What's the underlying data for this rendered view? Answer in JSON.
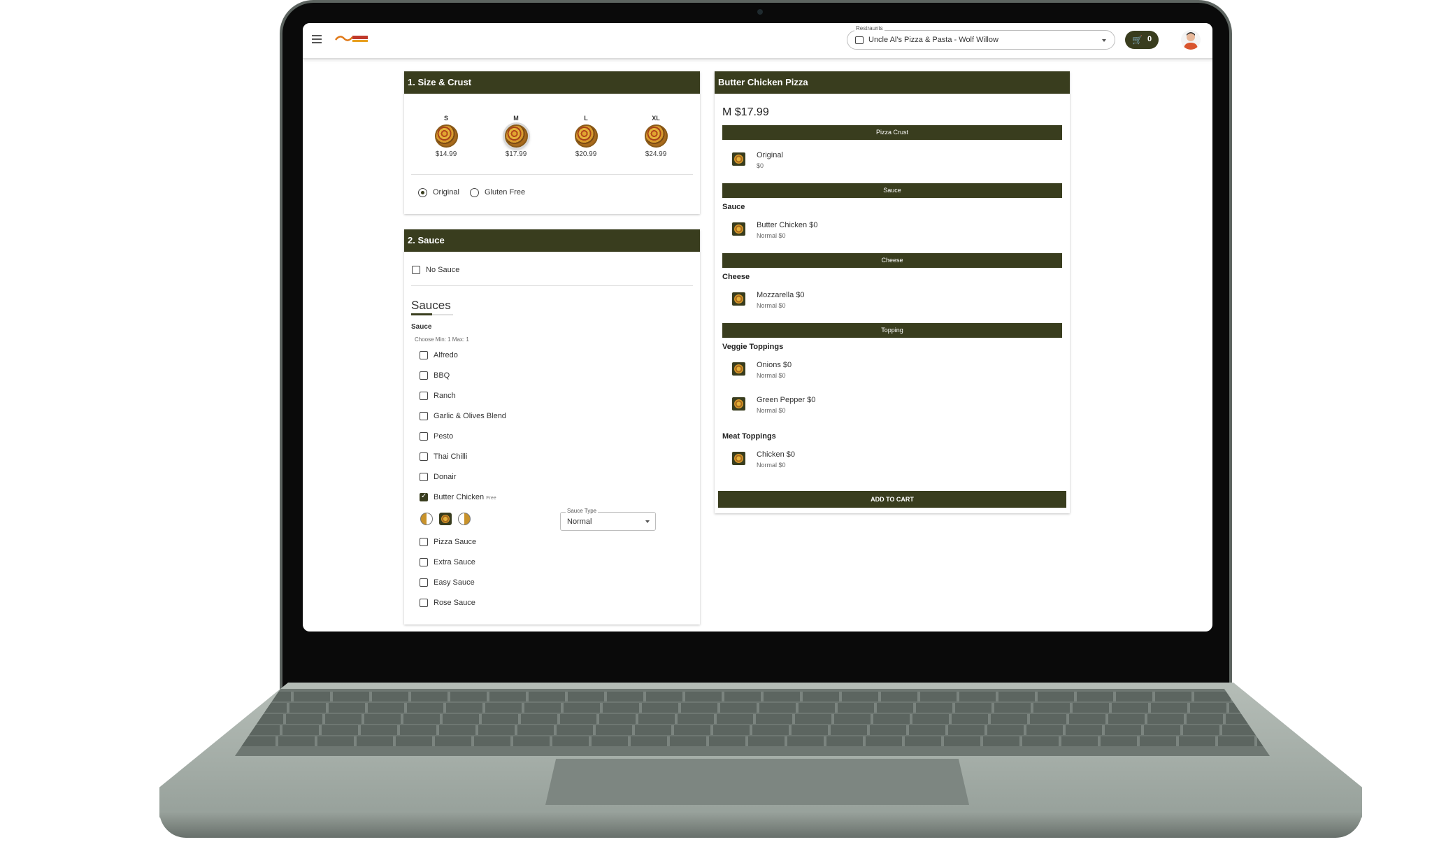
{
  "header": {
    "restaurant_label": "Restraunts",
    "restaurant_value": "Uncle Al's Pizza & Pasta - Wolf Willow",
    "cart_count": "0"
  },
  "size_crust": {
    "title": "1. Size & Crust",
    "sizes": [
      {
        "letter": "S",
        "price": "$14.99"
      },
      {
        "letter": "M",
        "price": "$17.99"
      },
      {
        "letter": "L",
        "price": "$20.99"
      },
      {
        "letter": "XL",
        "price": "$24.99"
      }
    ],
    "selected_size": "M",
    "crusts": [
      "Original",
      "Gluten Free"
    ],
    "selected_crust": "Original"
  },
  "sauce": {
    "title": "2. Sauce",
    "no_sauce_label": "No Sauce",
    "section_title": "Sauces",
    "group_label": "Sauce",
    "choose_hint": "Choose Min: 1 Max: 1",
    "options": [
      "Alfredo",
      "BBQ",
      "Ranch",
      "Garlic & Olives Blend",
      "Pesto",
      "Thai Chilli",
      "Donair",
      "Butter Chicken",
      "Pizza Sauce",
      "Extra Sauce",
      "Easy Sauce",
      "Rose Sauce"
    ],
    "selected": "Butter Chicken",
    "free_tag": "Free",
    "sauce_type_label": "Sauce Type",
    "sauce_type_value": "Normal"
  },
  "summary": {
    "title": "Butter Chicken Pizza",
    "price": "M $17.99",
    "crust_bar": "Pizza Crust",
    "crust_item": {
      "name": "Original",
      "sub": "$0"
    },
    "sauce_bar": "Sauce",
    "sauce_sub": "Sauce",
    "sauce_item": {
      "name": "Butter Chicken $0",
      "sub": "Normal $0"
    },
    "cheese_bar": "Cheese",
    "cheese_sub": "Cheese",
    "cheese_item": {
      "name": "Mozzarella $0",
      "sub": "Normal $0"
    },
    "topping_bar": "Topping",
    "veggie_sub": "Veggie Toppings",
    "veggie_items": [
      {
        "name": "Onions $0",
        "sub": "Normal $0"
      },
      {
        "name": "Green Pepper $0",
        "sub": "Normal $0"
      }
    ],
    "meat_sub": "Meat Toppings",
    "meat_items": [
      {
        "name": "Chicken $0",
        "sub": "Normal $0"
      }
    ],
    "add_to_cart": "ADD TO CART"
  },
  "colors": {
    "accent": "#393d1e"
  },
  "icons": [
    "menu-icon",
    "logo",
    "store-icon",
    "cart-icon",
    "avatar",
    "pizza-icon",
    "placement-left-icon",
    "placement-whole-icon",
    "placement-right-icon",
    "chevron-down-icon"
  ]
}
